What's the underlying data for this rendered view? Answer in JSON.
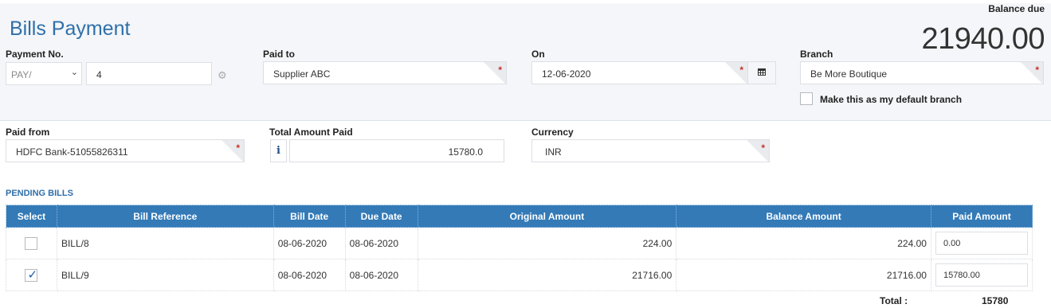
{
  "header": {
    "title": "Bills Payment",
    "balance_due_label": "Balance due",
    "balance_due_value": "21940.00"
  },
  "form": {
    "payment_no": {
      "label": "Payment No.",
      "prefix": "PAY/",
      "number": "4"
    },
    "paid_to": {
      "label": "Paid to",
      "value": "Supplier ABC"
    },
    "on": {
      "label": "On",
      "value": "12-06-2020"
    },
    "branch": {
      "label": "Branch",
      "value": "Be More Boutique",
      "default_checkbox_label": "Make this as my default branch"
    },
    "paid_from": {
      "label": "Paid from",
      "value": "HDFC Bank-51055826311"
    },
    "total_amount_paid": {
      "label": "Total Amount Paid",
      "value": "15780.0",
      "info_icon": "i"
    },
    "currency": {
      "label": "Currency",
      "value": "INR"
    },
    "required_mark": "*"
  },
  "pending_bills": {
    "title": "PENDING BILLS",
    "columns": [
      "Select",
      "Bill Reference",
      "Bill Date",
      "Due Date",
      "Original Amount",
      "Balance Amount",
      "Paid Amount"
    ],
    "rows": [
      {
        "checked": false,
        "reference": "BILL/8",
        "bill_date": "08-06-2020",
        "due_date": "08-06-2020",
        "original": "224.00",
        "balance": "224.00",
        "paid": "0.00"
      },
      {
        "checked": true,
        "reference": "BILL/9",
        "bill_date": "08-06-2020",
        "due_date": "08-06-2020",
        "original": "21716.00",
        "balance": "21716.00",
        "paid": "15780.00"
      }
    ],
    "total_label": "Total :",
    "total_value": "15780"
  },
  "icons": {
    "gear": "gear-icon",
    "calendar": "calendar-icon",
    "info": "info-icon",
    "chevron": "chevron-down-icon",
    "check": "checkmark-icon"
  },
  "colors": {
    "accent": "#2f6fa9",
    "table_header": "#337ab7",
    "required": "#c9302c"
  }
}
